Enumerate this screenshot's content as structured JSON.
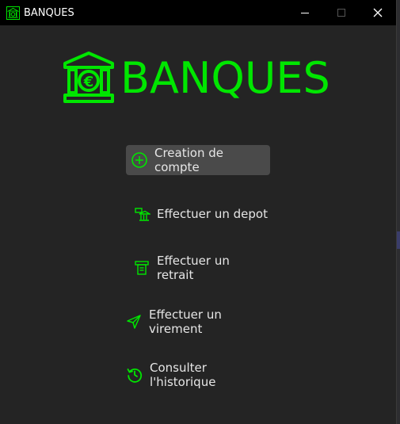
{
  "window": {
    "title": "BANQUES",
    "icon": "bank-icon"
  },
  "titlebar_controls": {
    "minimize": "minimize-icon",
    "maximize": "maximize-icon",
    "close": "close-icon"
  },
  "header": {
    "logo_icon": "bank-euro-icon",
    "title": "BANQUES"
  },
  "menu": {
    "items": [
      {
        "label": "Creation de compte",
        "icon": "plus-circle-icon",
        "active": true
      },
      {
        "label": "Effectuer un depot",
        "icon": "deposit-icon",
        "active": false
      },
      {
        "label": "Effectuer un retrait",
        "icon": "withdraw-icon",
        "active": false
      },
      {
        "label": "Effectuer un virement",
        "icon": "transfer-icon",
        "active": false
      },
      {
        "label": "Consulter l'historique",
        "icon": "history-icon",
        "active": false
      }
    ]
  },
  "colors": {
    "accent": "#00e600",
    "background": "#242424",
    "titlebar": "#000000",
    "text": "#e6e6e6",
    "active_button": "#4a4a4a"
  }
}
